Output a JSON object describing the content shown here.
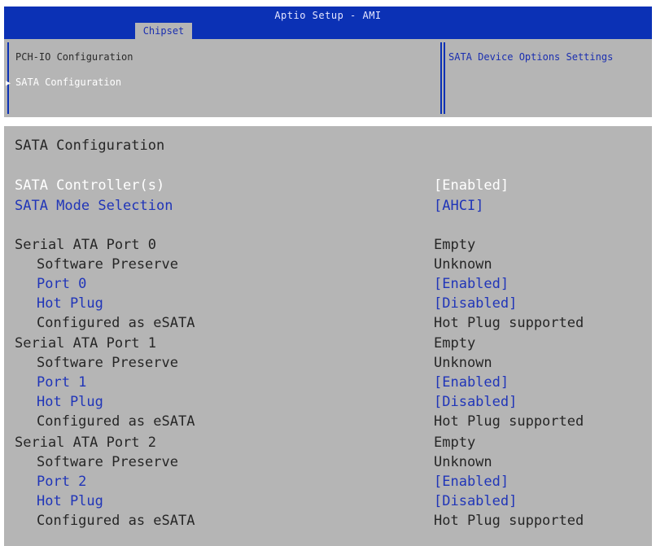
{
  "header": {
    "title": "Aptio Setup - AMI",
    "active_tab": "Chipset"
  },
  "top_panel": {
    "section_title": "PCH-IO Configuration",
    "menu_item": "SATA Configuration",
    "help_text": "SATA Device Options Settings"
  },
  "sata_page": {
    "title": "SATA Configuration",
    "controller": {
      "label": "SATA Controller(s)",
      "value": "[Enabled]"
    },
    "mode": {
      "label": "SATA Mode Selection",
      "value": "[AHCI]"
    },
    "ports": [
      {
        "label": "Serial ATA Port 0",
        "status": "Empty",
        "software_preserve_label": "Software Preserve",
        "software_preserve_value": "Unknown",
        "port_label": "Port 0",
        "port_value": "[Enabled]",
        "hotplug_label": "Hot Plug",
        "hotplug_value": "[Disabled]",
        "esata_label": "Configured as eSATA",
        "esata_value": "Hot Plug supported"
      },
      {
        "label": "Serial ATA Port 1",
        "status": "Empty",
        "software_preserve_label": "Software Preserve",
        "software_preserve_value": "Unknown",
        "port_label": "Port 1",
        "port_value": "[Enabled]",
        "hotplug_label": "Hot Plug",
        "hotplug_value": "[Disabled]",
        "esata_label": "Configured as eSATA",
        "esata_value": "Hot Plug supported"
      },
      {
        "label": "Serial ATA Port 2",
        "status": "Empty",
        "software_preserve_label": "Software Preserve",
        "software_preserve_value": "Unknown",
        "port_label": "Port 2",
        "port_value": "[Enabled]",
        "hotplug_label": "Hot Plug",
        "hotplug_value": "[Disabled]",
        "esata_label": "Configured as eSATA",
        "esata_value": "Hot Plug supported"
      }
    ]
  },
  "colors": {
    "title_bar": "#0b31b5",
    "panel_bg": "#b5b5b5",
    "selectable_text": "#2035b8",
    "highlight_text": "#ffffff",
    "static_text": "#262626"
  },
  "icons": {
    "menu_arrow": "triangle-right-icon"
  }
}
